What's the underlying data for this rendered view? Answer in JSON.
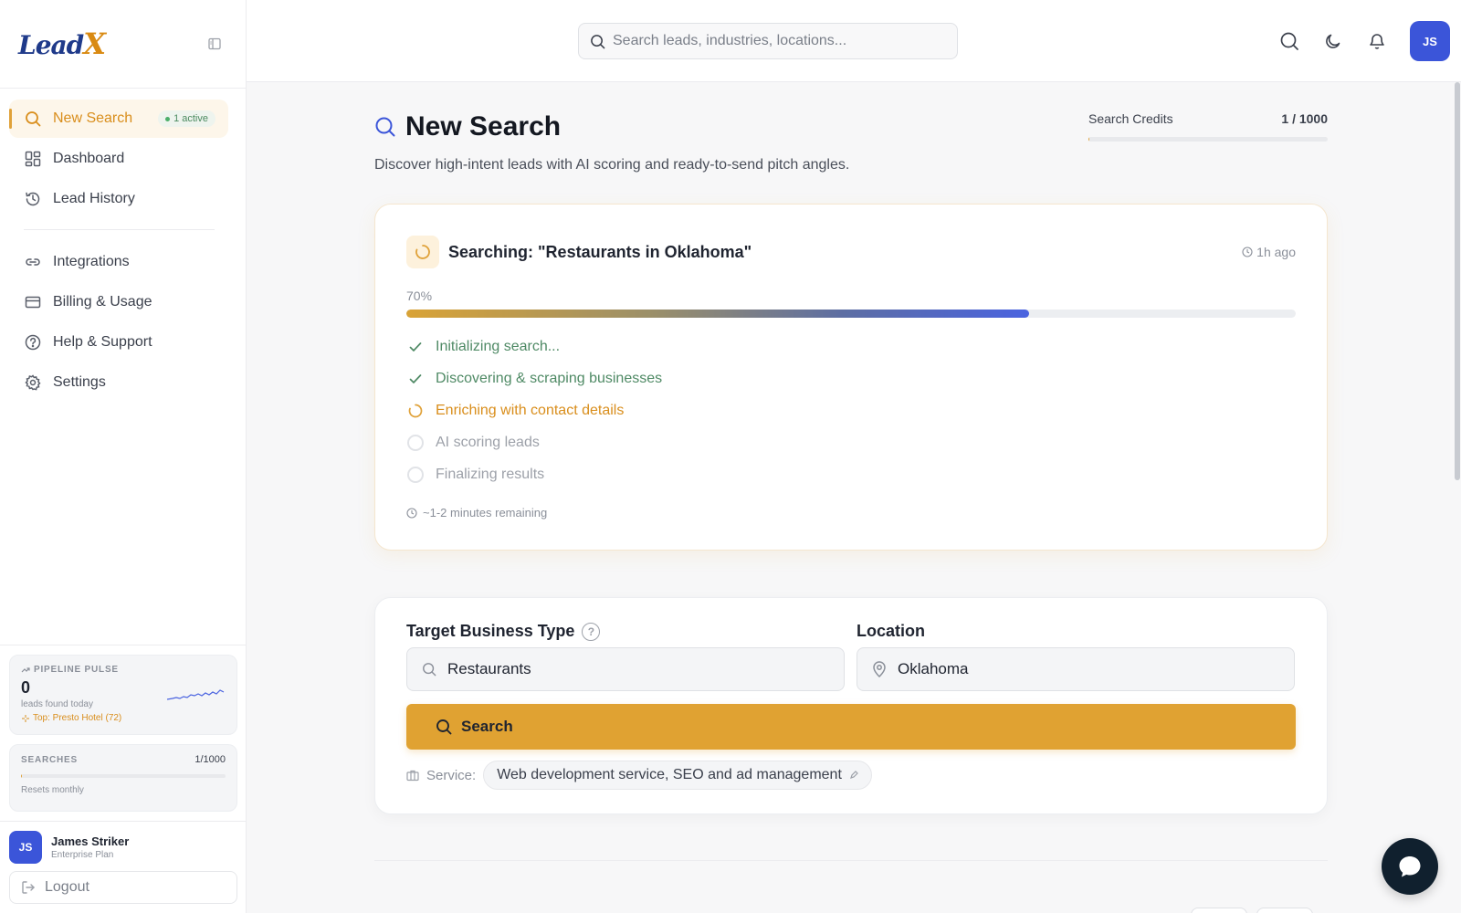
{
  "brand": {
    "logo_part1": "Lead",
    "logo_part2": "X"
  },
  "sidebar": {
    "items": [
      {
        "label": "New Search",
        "icon": "search-icon",
        "badge": "1 active",
        "active": true
      },
      {
        "label": "Dashboard",
        "icon": "dashboard-icon"
      },
      {
        "label": "Lead History",
        "icon": "history-icon"
      },
      {
        "label": "Integrations",
        "icon": "link-icon"
      },
      {
        "label": "Billing & Usage",
        "icon": "credit-card-icon"
      },
      {
        "label": "Help & Support",
        "icon": "help-circle-icon"
      },
      {
        "label": "Settings",
        "icon": "gear-icon"
      }
    ],
    "pulse": {
      "label": "PIPELINE PULSE",
      "value": "0",
      "sub": "leads found today",
      "top": "Top: Presto Hotel (72)"
    },
    "searches": {
      "label": "SEARCHES",
      "count": "1/1000",
      "used_fraction": 0.001,
      "note": "Resets monthly"
    },
    "user": {
      "initials": "JS",
      "name": "James Striker",
      "plan": "Enterprise Plan"
    },
    "logout_label": "Logout"
  },
  "topbar": {
    "search_placeholder": "Search leads, industries, locations...",
    "avatar_initials": "JS"
  },
  "main": {
    "title": "New Search",
    "subtitle": "Discover high-intent leads with AI scoring and ready-to-send pitch angles.",
    "credits": {
      "label": "Search Credits",
      "count": "1 / 1000",
      "used_fraction": 0.001
    }
  },
  "progress": {
    "title": "Searching: \"Restaurants in Oklahoma\"",
    "time": "1h ago",
    "percent_label": "70%",
    "percent": 70,
    "steps": [
      {
        "label": "Initializing search...",
        "status": "done"
      },
      {
        "label": "Discovering & scraping businesses",
        "status": "done"
      },
      {
        "label": "Enriching with contact details",
        "status": "current"
      },
      {
        "label": "AI scoring leads",
        "status": "pending"
      },
      {
        "label": "Finalizing results",
        "status": "pending"
      }
    ],
    "remaining": "~1-2 minutes remaining"
  },
  "form": {
    "business_label": "Target Business Type",
    "business_value": "Restaurants",
    "location_label": "Location",
    "location_value": "Oklahoma",
    "search_label": "Search",
    "service_label": "Service:",
    "service_value": "Web development service, SEO and ad management"
  },
  "colors": {
    "accent": "#e0a232",
    "primary_blue": "#3b55d9",
    "success": "#4f8a65",
    "chat": "#10202e"
  }
}
